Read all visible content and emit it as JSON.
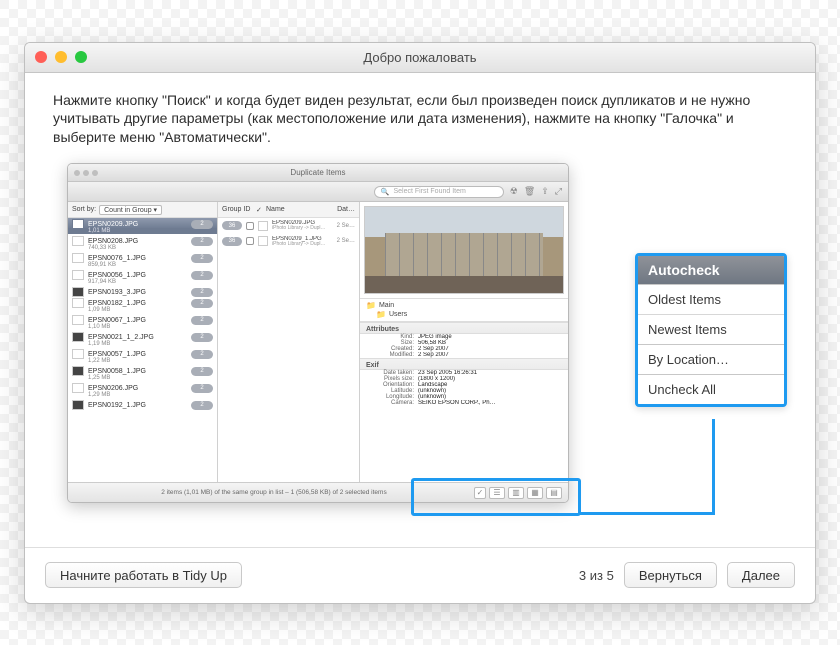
{
  "window": {
    "title": "Добро пожаловать"
  },
  "instructions": "Нажмите кнопку \"Поиск\" и когда будет виден результат, если был произведен поиск дупликатов и не нужно учитывать другие параметры (как местоположение или дата изменения), нажмите на кнопку \"Галочка\" и выберите меню \"Автоматически\".",
  "inner_app": {
    "title": "Duplicate Items",
    "search_placeholder": "Select First Found Item",
    "sort_label": "Sort by:",
    "sort_value": "Count in Group",
    "mid_headers": {
      "group": "Group ID",
      "name": "Name",
      "date": "Dat…"
    },
    "files": [
      {
        "name": "EPSN0209.JPG",
        "size": "1,01 MB",
        "count": "2",
        "selected": true
      },
      {
        "name": "EPSN0208.JPG",
        "size": "740,33 KB",
        "count": "2"
      },
      {
        "name": "EPSN0076_1.JPG",
        "size": "859,91 KB",
        "count": "2"
      },
      {
        "name": "EPSN0056_1.JPG",
        "size": "917,94 KB",
        "count": "2"
      },
      {
        "name": "EPSN0193_3.JPG",
        "size": "",
        "count": "2",
        "dark": true
      },
      {
        "name": "EPSN0182_1.JPG",
        "size": "1,09 MB",
        "count": "2"
      },
      {
        "name": "EPSN0067_1.JPG",
        "size": "1,10 MB",
        "count": "2"
      },
      {
        "name": "EPSN0021_1_2.JPG",
        "size": "1,19 MB",
        "count": "2",
        "dark": true
      },
      {
        "name": "EPSN0057_1.JPG",
        "size": "1,22 MB",
        "count": "2"
      },
      {
        "name": "EPSN0058_1.JPG",
        "size": "1,25 MB",
        "count": "2",
        "dark": true
      },
      {
        "name": "EPSN0206.JPG",
        "size": "1,29 MB",
        "count": "2"
      },
      {
        "name": "EPSN0192_1.JPG",
        "size": "",
        "count": "2",
        "dark": true
      }
    ],
    "group_items": [
      {
        "group": "36",
        "name": "EPSN0209.JPG",
        "path": "iPhoto Library -> Dupl…",
        "date": "2 Se…"
      },
      {
        "group": "36",
        "name": "EPSN0209_1.JPG",
        "path": "iPhoto Library -> Dupl…",
        "date": "2 Se…"
      }
    ],
    "folders": {
      "main": "Main",
      "users": "Users"
    },
    "attributes": {
      "heading": "Attributes",
      "kind_label": "Kind:",
      "kind": "JPEG image",
      "size_label": "Size:",
      "size": "506,58 KB",
      "created_label": "Created:",
      "created": "2 Sep 2007",
      "modified_label": "Modified:",
      "modified": "2 Sep 2007"
    },
    "exif": {
      "heading": "Exif",
      "date_taken_label": "Date taken:",
      "date_taken": "23 Sep 2005 16:26:31",
      "pixels_label": "Pixels size:",
      "pixels": "(1800 x 1200)",
      "orient_label": "Orientation:",
      "orient": "Landscape",
      "lat_label": "Latitude:",
      "lat": "(unknown)",
      "lon_label": "Longitude:",
      "lon": "(unknown)",
      "camera_label": "Camera:",
      "camera": "SEIKO EPSON CORP., Ph…"
    },
    "footer": "2 items (1,01 MB) of the same group in list – 1 (506,58 KB) of 2 selected items"
  },
  "callout": {
    "autocheck": "Autocheck",
    "oldest": "Oldest Items",
    "newest": "Newest Items",
    "by_location": "By Location…",
    "uncheck_all": "Uncheck All"
  },
  "footer": {
    "start": "Начните работать в Tidy Up",
    "page": "3 из 5",
    "back": "Вернуться",
    "next": "Далее"
  }
}
